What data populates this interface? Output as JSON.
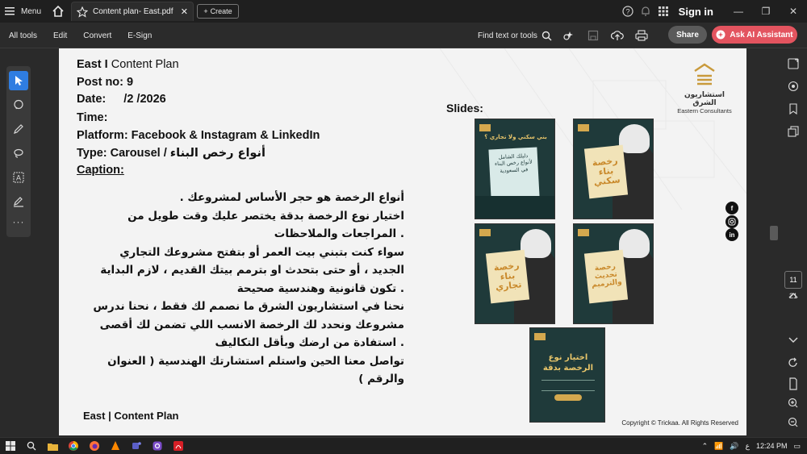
{
  "titlebar": {
    "menu_label": "Menu",
    "tab_title": "Content plan- East.pdf",
    "create_label": "Create",
    "sign_in": "Sign in"
  },
  "toolbar": {
    "items": [
      "All tools",
      "Edit",
      "Convert",
      "E-Sign"
    ],
    "find_label": "Find text or tools",
    "share_label": "Share",
    "ai_label": "Ask AI Assistant"
  },
  "document": {
    "header_brand": "East I",
    "header_title": "Content Plan",
    "post_label": "Post no:",
    "post_value": "9",
    "date_label": "Date:",
    "date_value": "/2 /2026",
    "time_label": "Time:",
    "platform_line": "Platform: Facebook & Instagram & LinkedIn",
    "type_label": "Type: Carousel /",
    "type_value": "أنواع رخص البناء",
    "caption_label": "Caption:",
    "caption_lines": [
      "أنواع الرخصة هو حجر الأساس لمشروعك .",
      "اختيار نوع الرخصة بدقة يختصر عليك وقت طويل من",
      ". المراجعات والملاحظات",
      "سواء كنت بتبني بيت العمر أو بتفتح مشروعك التجاري",
      "الجديد ، أو حتى بتحدث او بترمم بيتك القديم ، لازم البداية",
      ". تكون قانونية وهندسية صحيحة",
      "نحنا في استشاريون الشرق ما نصمم لك فقط ، نحنا ندرس",
      "مشروعك ونحدد لك الرخصة الانسب اللي تضمن لك أقصى",
      ". استفادة من ارضك وبأقل التكاليف",
      "تواصل معنا الحين واستلم استشارتك الهندسية ( العنوان",
      "والرقم )"
    ],
    "slides_label": "Slides:",
    "logo_ar": "استشاريون الشرق",
    "logo_en": "Eastern Consultants",
    "footer_left": "East | Content Plan",
    "copyright": "Copyright © Trickaa. All Rights Reserved",
    "slides": [
      {
        "text": "دليلك الشامل لأنواع رخص البناء في السعودية",
        "heading": "بني سكني ولا تجاري ؟"
      },
      {
        "text": "رخصة بناء سكني"
      },
      {
        "text": "رخصة بناء تجاري"
      },
      {
        "text": "رخصة تحديث والترميم"
      },
      {
        "text": "اختيار نوع الرخصة بدقة"
      }
    ]
  },
  "pagination": {
    "current": "11",
    "total": "21"
  },
  "taskbar": {
    "lang": "ع",
    "time": "12:24 PM"
  },
  "colors": {
    "accent_blue": "#2f7de1",
    "ai_button": "#e3545f",
    "slide_bg": "#1f3a3a",
    "slide_gold": "#c9892b"
  }
}
